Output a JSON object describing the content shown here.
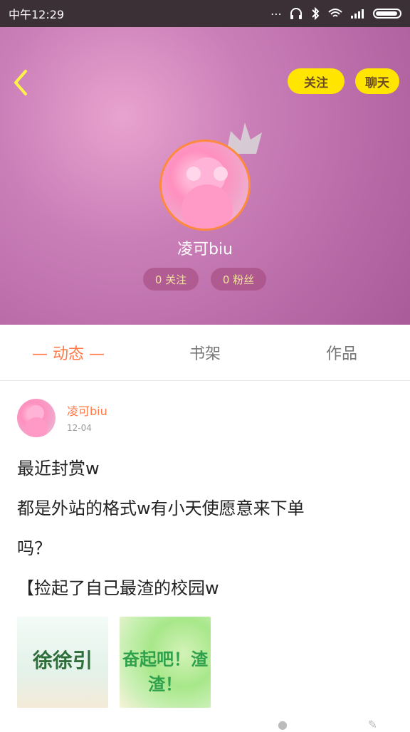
{
  "status_bar": {
    "time": "中午12:29",
    "icons": [
      "more-icon",
      "headphones-icon",
      "bluetooth-icon",
      "wifi-icon",
      "signal-icon",
      "battery-icon"
    ]
  },
  "profile": {
    "follow_button": "关注",
    "chat_button": "聊天",
    "username": "凌可biu",
    "stats": {
      "following": "0 关注",
      "followers": "0 粉丝"
    }
  },
  "tabs": {
    "items": [
      "— 动态 —",
      "书架",
      "作品"
    ]
  },
  "post": {
    "author": "凌可biu",
    "date": "12-04",
    "lines": [
      "最近封赏w",
      "都是外站的格式w有小天使愿意来下单",
      "吗？",
      "【捡起了自己最渣的校园w"
    ],
    "thumbs": [
      {
        "title": "徐徐引"
      },
      {
        "title": "奋起吧！渣渣！"
      }
    ]
  },
  "colors": {
    "accent": "#ff7a45",
    "pill": "#ffe500",
    "header_start": "#e8a3cf",
    "header_end": "#a95b99"
  }
}
